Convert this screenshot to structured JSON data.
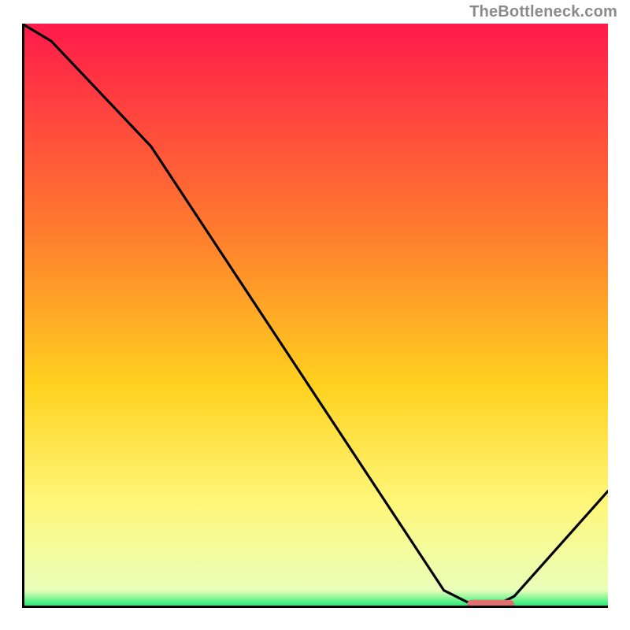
{
  "attribution": "TheBottleneck.com",
  "colors": {
    "gradient_top": "#ff1a4b",
    "gradient_mid1": "#ff7a2e",
    "gradient_mid2": "#ffd21f",
    "gradient_mid3": "#fff77a",
    "gradient_bottom": "#07e86d",
    "axis": "#000000",
    "line": "#000000",
    "marker": "#e2706f"
  },
  "chart_data": {
    "type": "line",
    "title": "",
    "xlabel": "",
    "ylabel": "",
    "xlim": [
      0,
      100
    ],
    "ylim": [
      0,
      100
    ],
    "series": [
      {
        "name": "curve",
        "x": [
          0,
          5,
          22,
          72,
          76,
          82,
          84,
          100
        ],
        "values": [
          100,
          97,
          79,
          3,
          1,
          1,
          2,
          20
        ]
      }
    ],
    "marker": {
      "name": "highlight-band",
      "x_start": 76,
      "x_end": 84,
      "y": 0.7
    }
  }
}
